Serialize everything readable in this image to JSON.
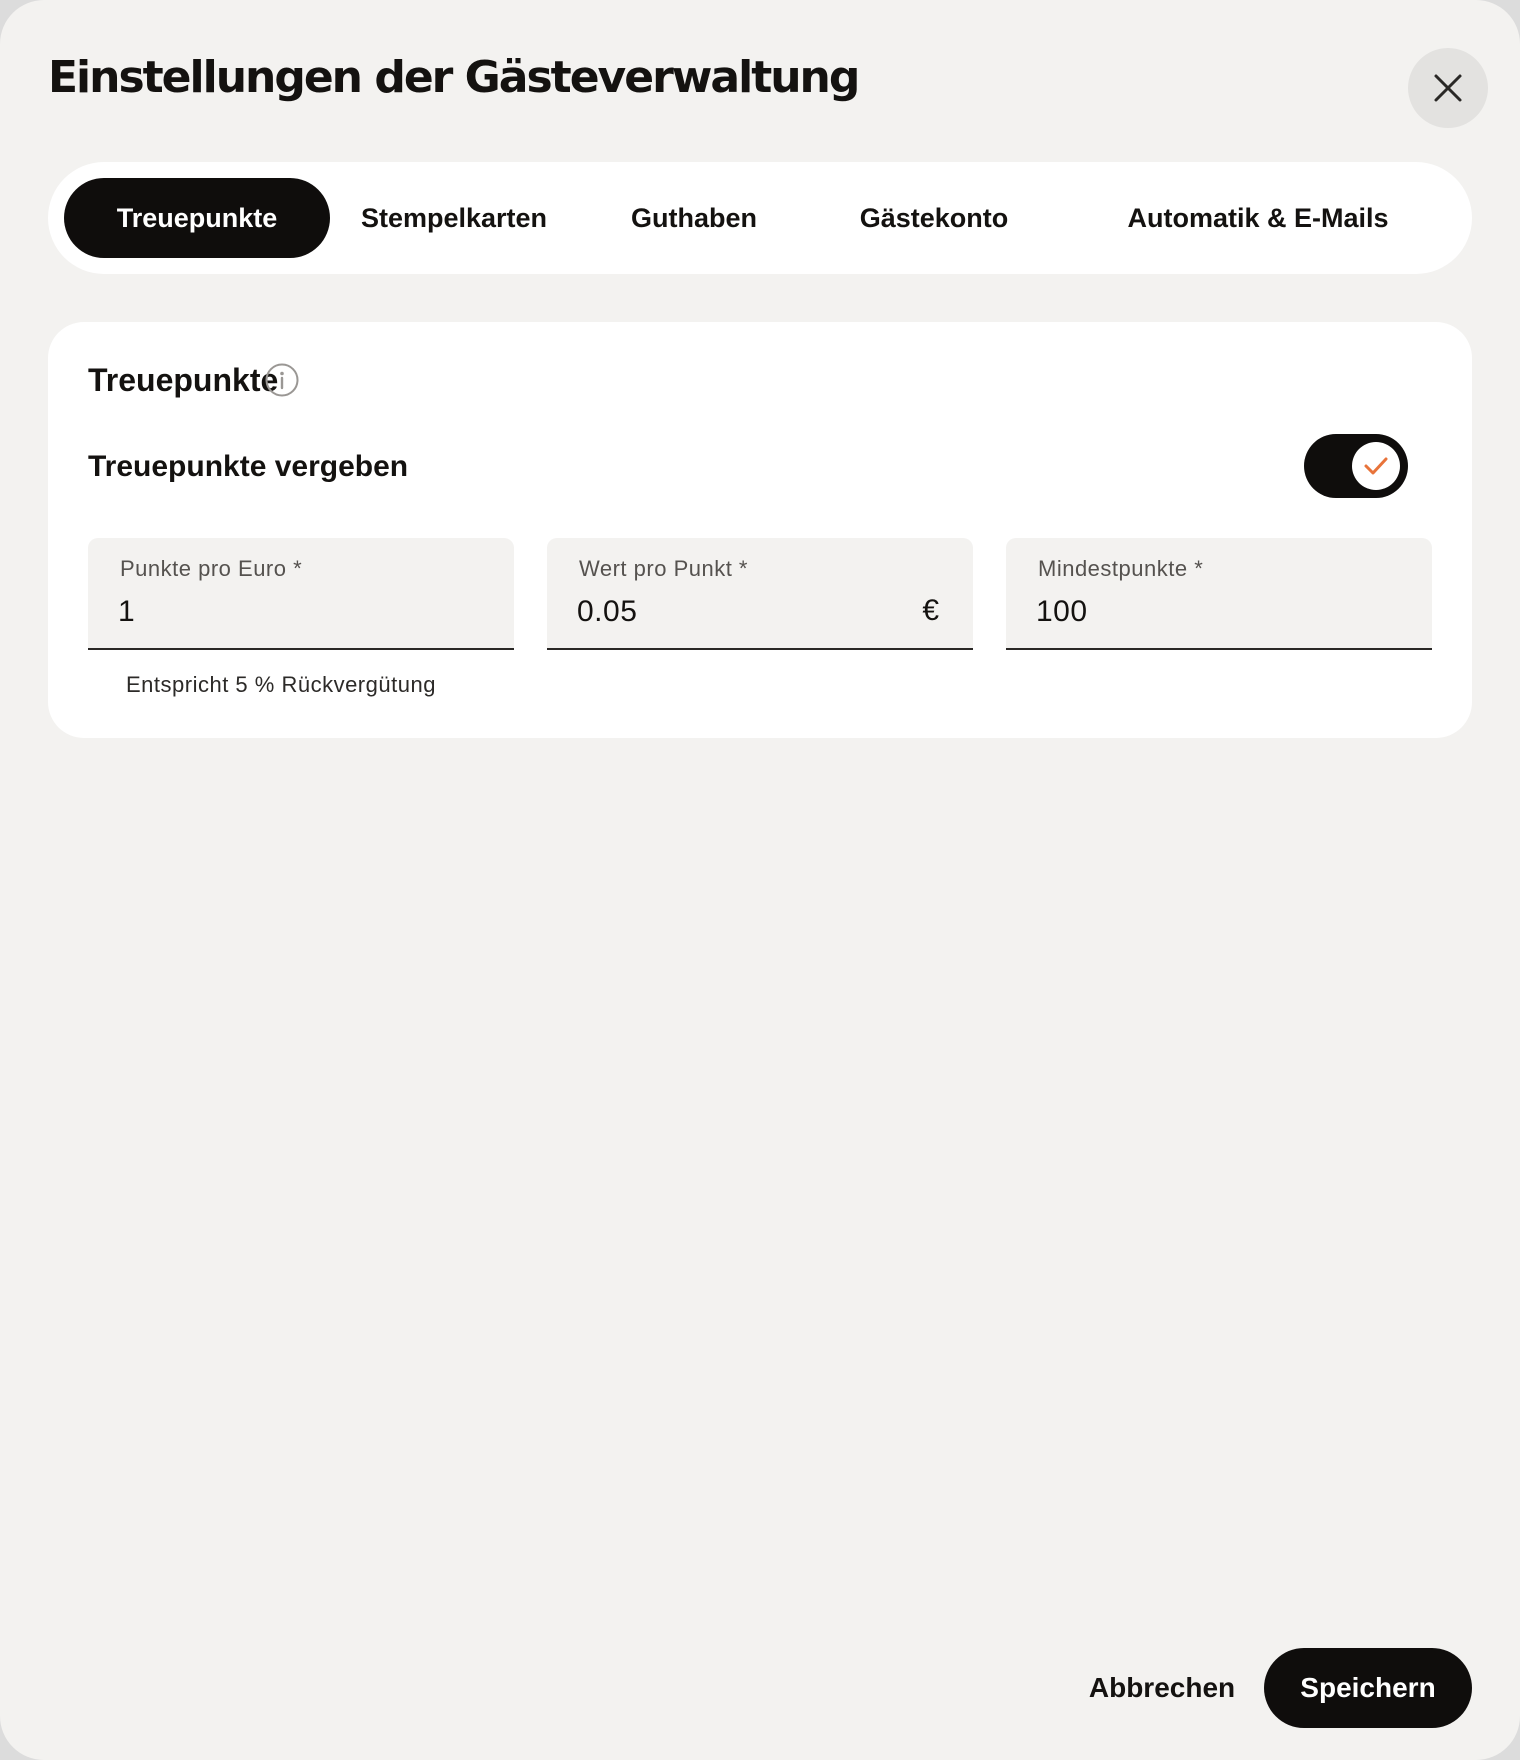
{
  "dialog": {
    "title": "Einstellungen der Gästeverwaltung"
  },
  "tabs": [
    {
      "label": "Treuepunkte",
      "active": true
    },
    {
      "label": "Stempelkarten",
      "active": false
    },
    {
      "label": "Guthaben",
      "active": false
    },
    {
      "label": "Gästekonto",
      "active": false
    },
    {
      "label": "Automatik & E-Mails",
      "active": false
    }
  ],
  "section": {
    "title": "Treuepunkte",
    "toggle_label": "Treuepunkte vergeben",
    "toggle_on": true,
    "fields": [
      {
        "label": "Punkte pro Euro *",
        "value": "1"
      },
      {
        "label": "Wert pro Punkt *",
        "value": "0.05",
        "suffix": "€"
      },
      {
        "label": "Mindestpunkte *",
        "value": "100"
      }
    ],
    "helper": "Entspricht 5 % Rückvergütung"
  },
  "footer": {
    "cancel_label": "Abbrechen",
    "save_label": "Speichern"
  },
  "colors": {
    "background": "#f3f2f0",
    "surface": "#ffffff",
    "primary": "#0f0d0c",
    "accent": "#e8733a"
  }
}
